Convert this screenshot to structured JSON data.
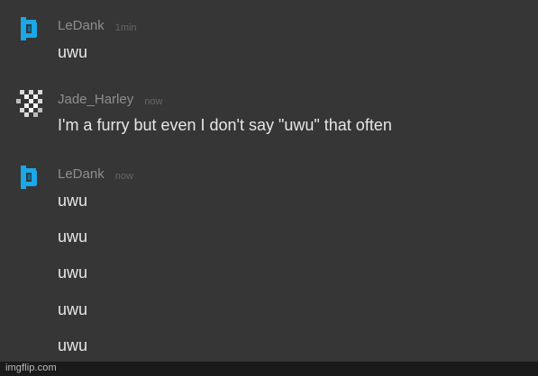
{
  "messages": [
    {
      "username": "LeDank",
      "time": "1min",
      "lines": [
        "uwu"
      ]
    },
    {
      "username": "Jade_Harley",
      "time": "now",
      "lines": [
        "I'm a furry but even I don't say \"uwu\" that often"
      ]
    },
    {
      "username": "LeDank",
      "time": "now",
      "lines": [
        "uwu",
        "uwu",
        "uwu",
        "uwu",
        "uwu"
      ]
    }
  ],
  "icons": {
    "ledank_avatar": "blue-bracket-avatar-icon",
    "jade_avatar": "checker-pattern-avatar-icon"
  },
  "colors": {
    "background": "#363636",
    "avatar_blue": "#1aa8e6"
  },
  "watermark": "imgflip.com"
}
